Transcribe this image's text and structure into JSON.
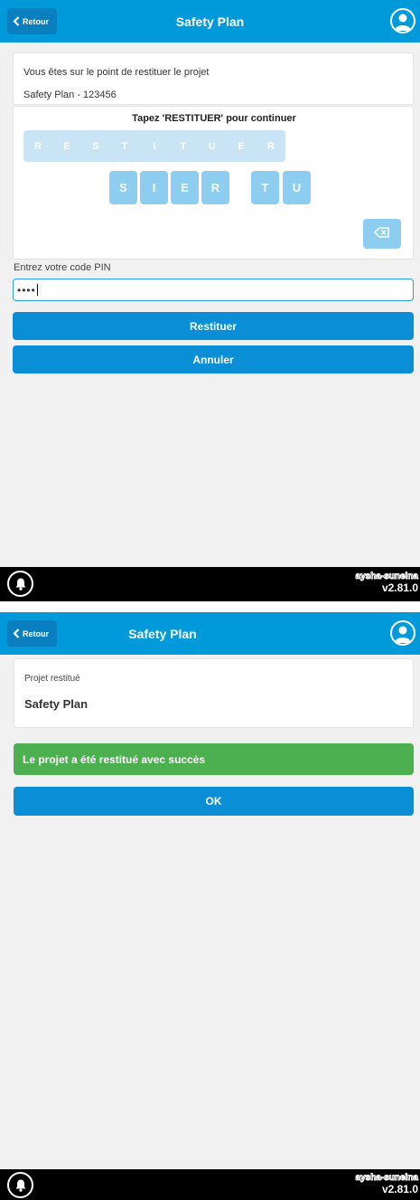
{
  "screen1": {
    "header": {
      "back_label": "Retour",
      "title": "Safety Plan"
    },
    "info": {
      "line1": "Vous êtes sur le point de restituer le projet",
      "line2": "Safety Plan - 123456"
    },
    "puzzle": {
      "instruction": "Tapez 'RESTITUER' pour continuer",
      "target_letters": [
        "R",
        "E",
        "S",
        "T",
        "I",
        "T",
        "U",
        "E",
        "R"
      ],
      "keys": [
        "S",
        "I",
        "E",
        "R",
        "T",
        "U"
      ],
      "backspace_icon": "backspace-icon"
    },
    "pin": {
      "label": "Entrez votre code PIN",
      "value": "••••"
    },
    "buttons": {
      "restore": "Restituer",
      "cancel": "Annuler"
    },
    "footer": {
      "brand": "aysha-suneina",
      "version": "v2.81.0"
    }
  },
  "screen2": {
    "header": {
      "back_label": "Retour",
      "title": "Safety Plan"
    },
    "card": {
      "label": "Projet restitué",
      "project": "Safety Plan"
    },
    "success_message": "Le projet a été restitué avec succès",
    "ok_button": "OK",
    "footer": {
      "brand": "aysha-suneina",
      "version": "v2.81.0"
    }
  },
  "colors": {
    "primary": "#0099da",
    "button": "#0a8fd6",
    "success": "#4caf50",
    "key": "#8ccdf0",
    "target": "#c8e4f5"
  }
}
